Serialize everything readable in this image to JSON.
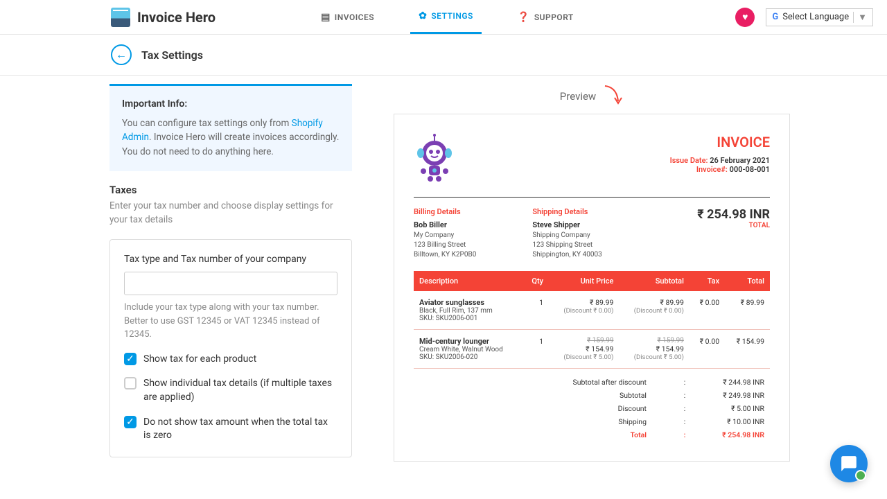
{
  "app": {
    "name": "Invoice Hero"
  },
  "nav": {
    "invoices": "INVOICES",
    "settings": "SETTINGS",
    "support": "SUPPORT"
  },
  "lang": "Select Language",
  "pageTitle": "Tax Settings",
  "info": {
    "title": "Important Info:",
    "text1": "You can configure tax settings only from ",
    "link": "Shopify Admin",
    "text2": ". Invoice Hero will create invoices accordingly. You do not need to do anything here."
  },
  "taxes": {
    "heading": "Taxes",
    "sub": "Enter your tax number and choose display settings for your tax details"
  },
  "form": {
    "label": "Tax type and Tax number of your company",
    "help": "Include your tax type along with your tax number. Better to use GST 12345 or VAT 12345 instead of 12345.",
    "cb1": "Show tax for each product",
    "cb2": "Show individual tax details (if multiple taxes are applied)",
    "cb3": "Do not show tax amount when the total tax is zero"
  },
  "preview": {
    "label": "Preview",
    "invoiceTitle": "INVOICE",
    "issueDateLabel": "Issue Date:",
    "issueDate": "26 February 2021",
    "invoiceNumLabel": "Invoice#:",
    "invoiceNum": "000-08-001",
    "billing": {
      "heading": "Billing Details",
      "name": "Bob Biller",
      "company": "My Company",
      "street": "123 Billing Street",
      "city": "Billtown, KY K2P0B0"
    },
    "shipping": {
      "heading": "Shipping Details",
      "name": "Steve Shipper",
      "company": "Shipping Company",
      "street": "123 Shipping Street",
      "city": "Shippington, KY 40003"
    },
    "grandTotal": "₹ 254.98 INR",
    "totalLabel": "TOTAL",
    "cols": {
      "desc": "Description",
      "qty": "Qty",
      "unit": "Unit Price",
      "subtotal": "Subtotal",
      "tax": "Tax",
      "total": "Total"
    },
    "row1": {
      "name": "Aviator sunglasses",
      "detail": "Black, Full Rim, 137 mm",
      "sku": "SKU: SKU2006-001",
      "qty": "1",
      "unit": "₹ 89.99",
      "unitDisc": "(Discount ₹ 0.00)",
      "sub": "₹ 89.99",
      "subDisc": "(Discount ₹ 0.00)",
      "tax": "₹ 0.00",
      "total": "₹ 89.99"
    },
    "row2": {
      "name": "Mid-century lounger",
      "detail": "Cream White, Walnut Wood",
      "sku": "SKU: SKU2006-020",
      "qty": "1",
      "unitOld": "₹ 159.99",
      "unit": "₹ 154.99",
      "unitDisc": "(Discount ₹ 5.00)",
      "subOld": "₹ 159.99",
      "sub": "₹ 154.99",
      "subDisc": "(Discount ₹ 5.00)",
      "tax": "₹ 0.00",
      "total": "₹ 154.99"
    },
    "summary": {
      "subAfter": {
        "label": "Subtotal after discount",
        "val": "₹ 244.98 INR"
      },
      "subtotal": {
        "label": "Subtotal",
        "val": "₹ 249.98 INR"
      },
      "discount": {
        "label": "Discount",
        "val": "₹ 5.00 INR"
      },
      "shipping": {
        "label": "Shipping",
        "val": "₹ 10.00 INR"
      },
      "total": {
        "label": "Total",
        "val": "₹ 254.98 INR"
      }
    }
  }
}
